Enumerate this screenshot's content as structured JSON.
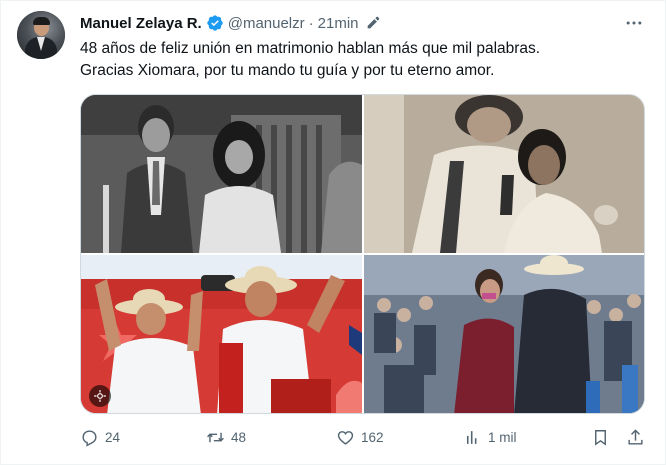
{
  "tweet": {
    "author_name": "Manuel Zelaya R.",
    "handle": "@manuelzr",
    "separator": "·",
    "time": "21min",
    "text_line1": "48 años de feliz unión en matrimonio hablan más que mil palabras.",
    "text_line2": "Gracias Xiomara, por tu mando tu guía y por tu eterno amor."
  },
  "actions": {
    "replies": "24",
    "retweets": "48",
    "likes": "162",
    "views": "1 mil"
  },
  "colors": {
    "verified_badge": "#1d9bf0",
    "secondary_text": "#536471",
    "primary_text": "#0f1419",
    "border": "#cfd9de"
  },
  "icons": [
    "verified-badge-icon",
    "edit-icon",
    "more-icon",
    "reply-icon",
    "retweet-icon",
    "like-icon",
    "views-icon",
    "bookmark-icon",
    "share-icon",
    "gif-icon"
  ]
}
